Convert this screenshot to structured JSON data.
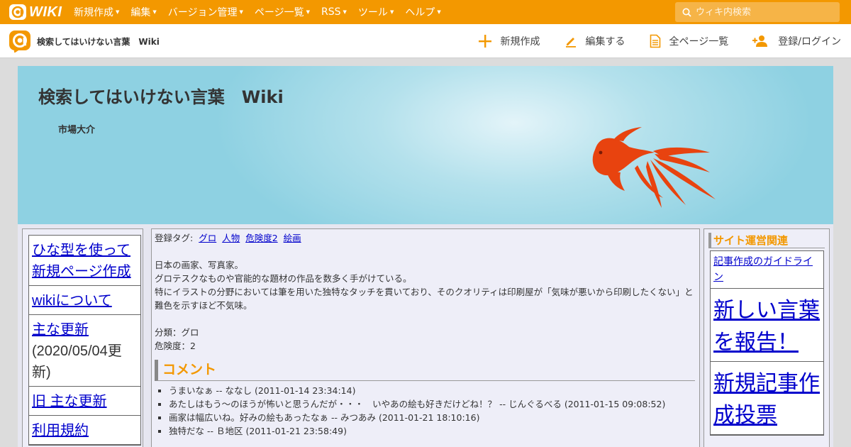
{
  "topbar": {
    "logo_text": "WIKI",
    "nav": [
      "新規作成",
      "編集",
      "バージョン管理",
      "ページ一覧",
      "RSS",
      "ツール",
      "ヘルプ"
    ],
    "search_placeholder": "ウィキ内検索"
  },
  "subbar": {
    "site_title": "検索してはいけない言葉　Wiki",
    "actions": [
      "新規作成",
      "編集する",
      "全ページ一覧",
      "登録/ログイン"
    ]
  },
  "banner": {
    "title": "検索してはいけない言葉　Wiki",
    "subtitle": "市場大介"
  },
  "left_menu": {
    "item1": "ひな型を使って新規ページ作成",
    "item2": "wikiについて",
    "item3_link": "主な更新",
    "item3_text": "(2020/05/04更新)",
    "item4": "旧 主な更新",
    "item5": "利用規約"
  },
  "main": {
    "tags_label": "登録タグ:",
    "tags": [
      "グロ",
      "人物",
      "危険度2",
      "絵画"
    ],
    "desc1": "日本の画家、写真家。",
    "desc2": "グロテスクなものや官能的な題材の作品を数多く手がけている。",
    "desc3": "特にイラストの分野においては筆を用いた独特なタッチを貫いており、そのクオリティは印刷屋が「気味が悪いから印刷したくない」と難色を示すほど不気味。",
    "category": "分類：グロ",
    "danger": "危険度：2",
    "comment_heading": "コメント",
    "comments": [
      "うまいなぁ -- ななし (2011-01-14 23:34:14)",
      "あたしはもう～のほうが怖いと思うんだが・・・　いやあの絵も好きだけどね！？ -- じんぐるべる (2011-01-15 09:08:52)",
      "画家は幅広いね。好みの絵もあったなぁ -- みつあみ (2011-01-21 18:10:16)",
      "独特だな -- Ｂ地区 (2011-01-21 23:58:49)"
    ]
  },
  "right": {
    "heading": "サイト運営関連",
    "item1": "記事作成のガイドライン",
    "item2": "新しい言葉を報告！",
    "item3": "新規記事作成投票"
  },
  "colors": {
    "accent": "#f39800",
    "banner": "#8ed1e2",
    "fish": "#e8430f",
    "link": "#0000cc"
  }
}
